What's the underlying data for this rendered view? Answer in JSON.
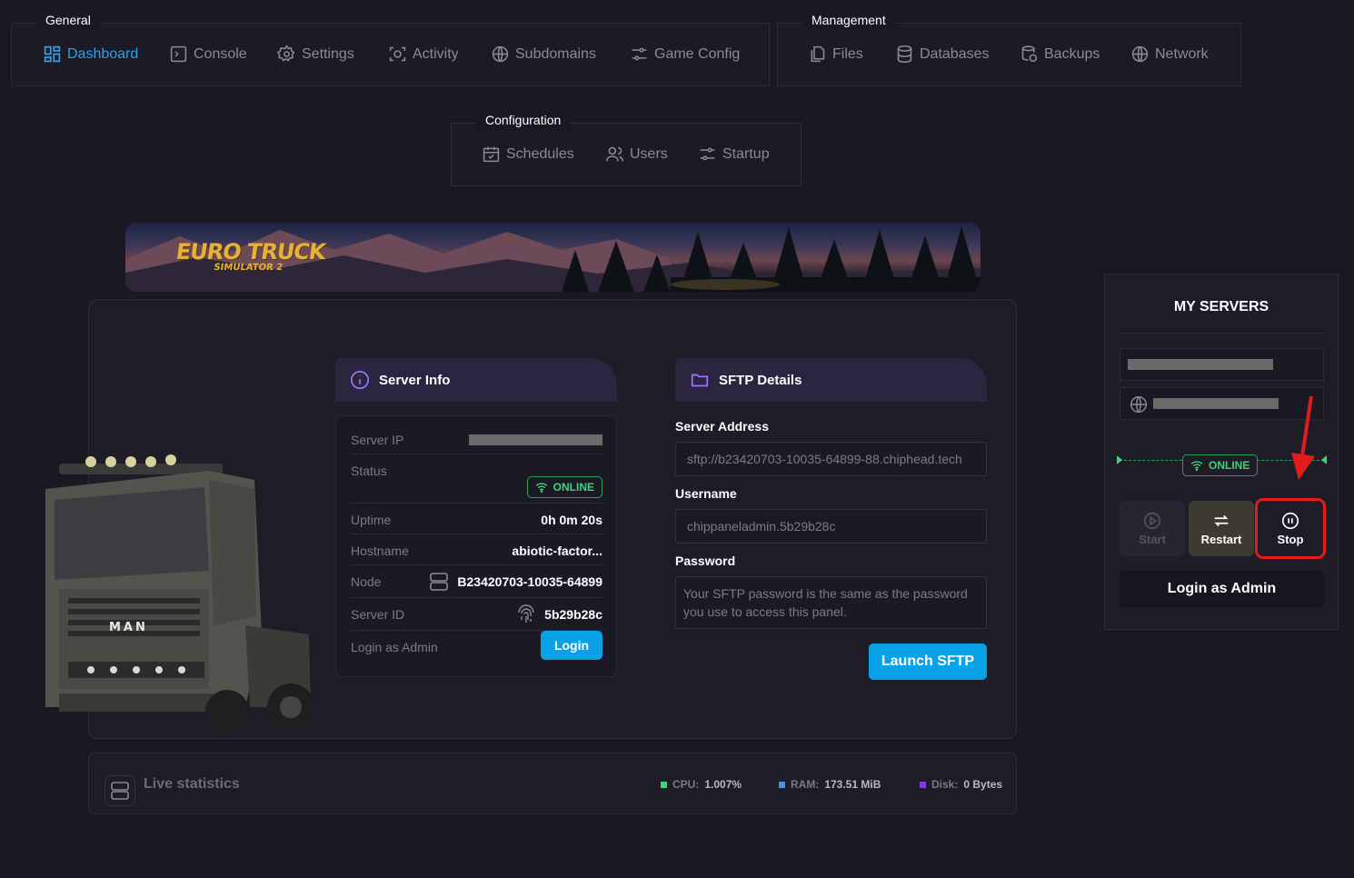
{
  "nav": {
    "general": {
      "title": "General",
      "items": [
        {
          "label": "Dashboard",
          "icon": "dashboard-icon",
          "active": true
        },
        {
          "label": "Console",
          "icon": "console-icon"
        },
        {
          "label": "Settings",
          "icon": "gear-icon"
        },
        {
          "label": "Activity",
          "icon": "activity-icon"
        },
        {
          "label": "Subdomains",
          "icon": "globe-icon"
        },
        {
          "label": "Game Config",
          "icon": "sliders-icon"
        }
      ]
    },
    "management": {
      "title": "Management",
      "items": [
        {
          "label": "Files",
          "icon": "files-icon"
        },
        {
          "label": "Databases",
          "icon": "database-icon"
        },
        {
          "label": "Backups",
          "icon": "backup-icon"
        },
        {
          "label": "Network",
          "icon": "globe-icon"
        }
      ]
    },
    "configuration": {
      "title": "Configuration",
      "items": [
        {
          "label": "Schedules",
          "icon": "calendar-icon"
        },
        {
          "label": "Users",
          "icon": "users-icon"
        },
        {
          "label": "Startup",
          "icon": "sliders-icon"
        }
      ]
    }
  },
  "banner": {
    "logo_line1": "EURO TRUCK",
    "logo_line2": "SIMULATOR 2"
  },
  "truck_brand": "MAN",
  "server_info": {
    "title": "Server Info",
    "rows": {
      "ip_label": "Server IP",
      "status_label": "Status",
      "status_value": "ONLINE",
      "uptime_label": "Uptime",
      "uptime_value": "0h 0m 20s",
      "hostname_label": "Hostname",
      "hostname_value": "abiotic-factor...",
      "node_label": "Node",
      "node_value": "B23420703-10035-64899",
      "server_id_label": "Server ID",
      "server_id_value": "5b29b28c",
      "login_admin_label": "Login as Admin",
      "login_button": "Login"
    }
  },
  "sftp": {
    "title": "SFTP Details",
    "address_label": "Server Address",
    "address_value": "sftp://b23420703-10035-64899-88.chiphead.tech",
    "username_label": "Username",
    "username_value": "chippaneladmin.5b29b28c",
    "password_label": "Password",
    "password_note": "Your SFTP password is the same as the password you use to access this panel.",
    "launch_button": "Launch SFTP"
  },
  "live_stats": {
    "title": "Live statistics",
    "cpu_label": "CPU:",
    "cpu_value": "1.007%",
    "ram_label": "RAM:",
    "ram_value": "173.51 MiB",
    "disk_label": "Disk:",
    "disk_value": "0 Bytes"
  },
  "my_servers": {
    "title": "MY SERVERS",
    "status": "ONLINE",
    "start_label": "Start",
    "restart_label": "Restart",
    "stop_label": "Stop",
    "login_admin": "Login as Admin"
  },
  "colors": {
    "accent_blue": "#0aa2e6",
    "online_green": "#3ed27a",
    "cpu": "#3ed27a",
    "ram": "#4a8fe8",
    "disk": "#7a3fd8",
    "highlight_red": "#e21b1b"
  }
}
